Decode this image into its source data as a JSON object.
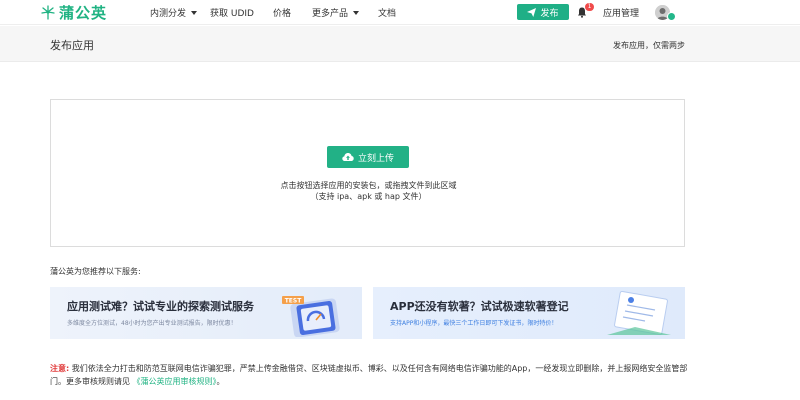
{
  "brand": {
    "name": "蒲公英",
    "color": "#20b383"
  },
  "nav": {
    "items": [
      {
        "label": "内测分发",
        "has_dropdown": true
      },
      {
        "label": "获取 UDID",
        "has_dropdown": false
      },
      {
        "label": "价格",
        "has_dropdown": false
      },
      {
        "label": "更多产品",
        "has_dropdown": true
      },
      {
        "label": "文档",
        "has_dropdown": false
      }
    ],
    "publish_label": "发布",
    "notification_count": "1",
    "app_manage_label": "应用管理",
    "icons": {
      "publish": "paper-plane-icon",
      "notifications": "bell-icon",
      "avatar": "user-avatar"
    }
  },
  "header": {
    "title": "发布应用",
    "subtitle": "发布应用，仅需两步"
  },
  "upload": {
    "button_label": "立刻上传",
    "button_icon": "cloud-upload-icon",
    "hint": "点击按钮选择应用的安装包，或拖拽文件到此区域",
    "formats": "（支持 ipa、apk 或 hap 文件）"
  },
  "recommend": {
    "title": "蒲公英为您推荐以下服务:",
    "cards": [
      {
        "title": "应用测试难？试试专业的探索测试服务",
        "desc": "多维度全方位测试，48小时为您产出专业测试报告，限时优惠！",
        "tag": "TEST"
      },
      {
        "title": "APP还没有软著？试试极速软著登记",
        "desc": "支持APP和小程序，最快三个工作日即可下发证书，限时特价！"
      }
    ]
  },
  "notice": {
    "label": "注意:",
    "text": "我们依法全力打击和防范互联网电信诈骗犯罪，严禁上传金融借贷、区块链虚拟币、博彩、以及任何含有网络电信诈骗功能的App，一经发现立即删除，并上报网络安全监管部门。更多审核规则请见",
    "link": "《蒲公英应用审核规则》",
    "end": "。"
  }
}
